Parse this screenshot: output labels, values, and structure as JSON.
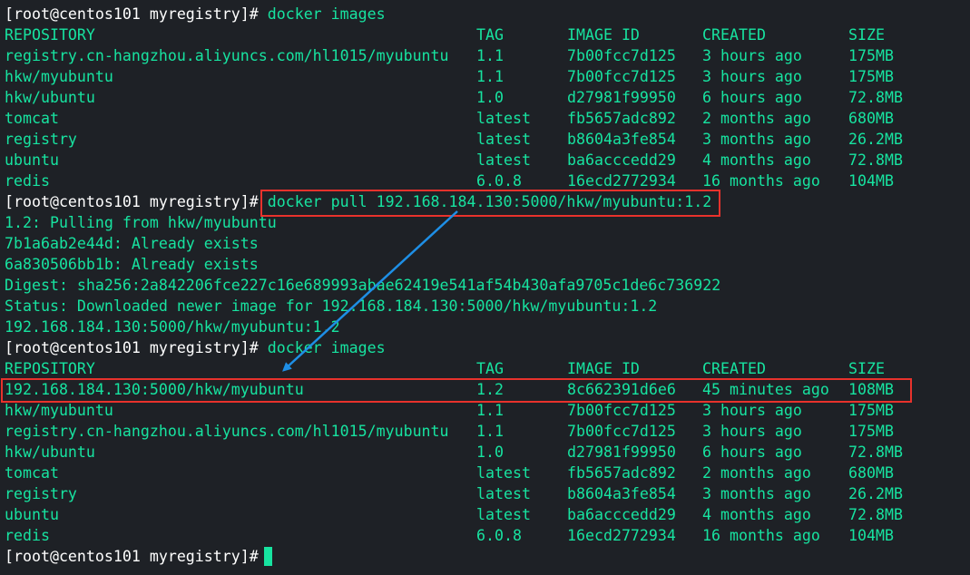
{
  "terminal": {
    "prompt": "[root@centos101 myregistry]#",
    "commands": {
      "images_1": "docker images",
      "pull": "docker pull 192.168.184.130:5000/hkw/myubuntu:1.2",
      "images_2": "docker images"
    },
    "headers": {
      "repository": "REPOSITORY",
      "tag": "TAG",
      "image_id": "IMAGE ID",
      "created": "CREATED",
      "size": "SIZE"
    },
    "images_before": [
      {
        "repo": "registry.cn-hangzhou.aliyuncs.com/hl1015/myubuntu",
        "tag": "1.1",
        "id": "7b00fcc7d125",
        "created": "3 hours ago",
        "size": "175MB"
      },
      {
        "repo": "hkw/myubuntu",
        "tag": "1.1",
        "id": "7b00fcc7d125",
        "created": "3 hours ago",
        "size": "175MB"
      },
      {
        "repo": "hkw/ubuntu",
        "tag": "1.0",
        "id": "d27981f99950",
        "created": "6 hours ago",
        "size": "72.8MB"
      },
      {
        "repo": "tomcat",
        "tag": "latest",
        "id": "fb5657adc892",
        "created": "2 months ago",
        "size": "680MB"
      },
      {
        "repo": "registry",
        "tag": "latest",
        "id": "b8604a3fe854",
        "created": "3 months ago",
        "size": "26.2MB"
      },
      {
        "repo": "ubuntu",
        "tag": "latest",
        "id": "ba6acccedd29",
        "created": "4 months ago",
        "size": "72.8MB"
      },
      {
        "repo": "redis",
        "tag": "6.0.8",
        "id": "16ecd2772934",
        "created": "16 months ago",
        "size": "104MB"
      }
    ],
    "pull_output": [
      "1.2: Pulling from hkw/myubuntu",
      "7b1a6ab2e44d: Already exists",
      "6a830506bb1b: Already exists",
      "Digest: sha256:2a842206fce227c16e689993abae62419e541af54b430afa9705c1de6c736922",
      "Status: Downloaded newer image for 192.168.184.130:5000/hkw/myubuntu:1.2",
      "192.168.184.130:5000/hkw/myubuntu:1.2"
    ],
    "images_after": [
      {
        "repo": "192.168.184.130:5000/hkw/myubuntu",
        "tag": "1.2",
        "id": "8c662391d6e6",
        "created": "45 minutes ago",
        "size": "108MB"
      },
      {
        "repo": "hkw/myubuntu",
        "tag": "1.1",
        "id": "7b00fcc7d125",
        "created": "3 hours ago",
        "size": "175MB"
      },
      {
        "repo": "registry.cn-hangzhou.aliyuncs.com/hl1015/myubuntu",
        "tag": "1.1",
        "id": "7b00fcc7d125",
        "created": "3 hours ago",
        "size": "175MB"
      },
      {
        "repo": "hkw/ubuntu",
        "tag": "1.0",
        "id": "d27981f99950",
        "created": "6 hours ago",
        "size": "72.8MB"
      },
      {
        "repo": "tomcat",
        "tag": "latest",
        "id": "fb5657adc892",
        "created": "2 months ago",
        "size": "680MB"
      },
      {
        "repo": "registry",
        "tag": "latest",
        "id": "b8604a3fe854",
        "created": "3 months ago",
        "size": "26.2MB"
      },
      {
        "repo": "ubuntu",
        "tag": "latest",
        "id": "ba6acccedd29",
        "created": "4 months ago",
        "size": "72.8MB"
      },
      {
        "repo": "redis",
        "tag": "6.0.8",
        "id": "16ecd2772934",
        "created": "16 months ago",
        "size": "104MB"
      }
    ]
  },
  "colors": {
    "background": "#1e2126",
    "prompt_text": "#ffffff",
    "output_text": "#17e3a0",
    "highlight_box": "#e8322c",
    "annotation_arrow": "#1e8fe6"
  }
}
